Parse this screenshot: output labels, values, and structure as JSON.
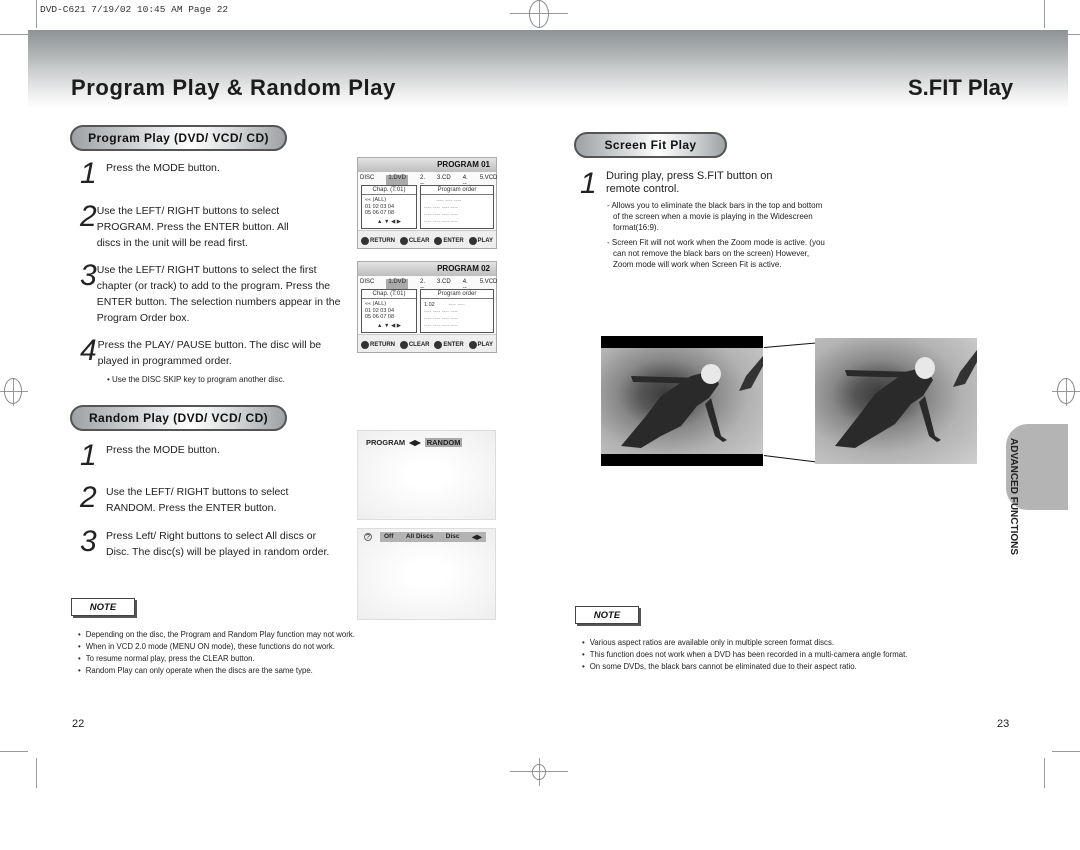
{
  "print_header": "DVD-C621  7/19/02 10:45 AM  Page 22",
  "left_page": {
    "title": "Program Play & Random Play",
    "page_number": "22",
    "program_section": {
      "heading": "Program Play (DVD/ VCD/ CD)",
      "steps": [
        {
          "num": "1",
          "text": "Press the MODE button."
        },
        {
          "num": "2",
          "text": "Use the LEFT/ RIGHT buttons to select PROGRAM. Press the ENTER button. All discs in the unit will be read first."
        },
        {
          "num": "3",
          "text": "Use the LEFT/ RIGHT buttons to select the first chapter (or track) to add to the program. Press the ENTER button. The selection numbers appear in the Program Order box."
        },
        {
          "num": "4",
          "text": "Press the PLAY/ PAUSE button. The disc will be played in programmed order."
        }
      ],
      "tip": "• Use the DISC SKIP key to program another disc."
    },
    "osd_screens": [
      {
        "title": "PROGRAM 01",
        "discs": [
          "DISC",
          "1.DVD",
          "2. ---",
          "3.CD",
          "4. ---",
          "5.VCD"
        ],
        "chap_header": "Chap. (T:01)",
        "all_label": "«« (ALL)",
        "chapters_row1": "01  02  03  04",
        "chapters_row2": "05  06  07  08",
        "arrows": "▲ ▼ ◀ ▶",
        "order_header": "Program order",
        "order_first": "",
        "footer": [
          "RETURN",
          "CLEAR",
          "ENTER",
          "PLAY"
        ]
      },
      {
        "title": "PROGRAM 02",
        "discs": [
          "DISC",
          "1.DVD",
          "2. ---",
          "3.CD",
          "4. ---",
          "5.VCD"
        ],
        "chap_header": "Chap. (T:01)",
        "all_label": "«« (ALL)",
        "chapters_row1": "01  02  03  04",
        "chapters_row2": "05  06  07  08",
        "arrows": "▲ ▼ ◀ ▶",
        "order_header": "Program order",
        "order_first": "1.02",
        "footer": [
          "RETURN",
          "CLEAR",
          "ENTER",
          "PLAY"
        ]
      }
    ],
    "random_section": {
      "heading": "Random Play (DVD/ VCD/ CD)",
      "steps": [
        {
          "num": "1",
          "text": "Press the MODE button."
        },
        {
          "num": "2",
          "text": "Use the LEFT/ RIGHT buttons to select RANDOM. Press the ENTER button."
        },
        {
          "num": "3",
          "text": "Press Left/ Right buttons to select All discs or Disc. The disc(s) will be played in random order."
        }
      ]
    },
    "random_osd": {
      "program_label": "PROGRAM",
      "arrows": "◀▶",
      "random_label": "RANDOM",
      "icon": "?",
      "options": [
        "Off",
        "All Discs",
        "Disc"
      ]
    },
    "note_label": "NOTE",
    "notes": [
      "Depending on the disc, the Program and Random Play function may not work.",
      "When in VCD 2.0 mode (MENU ON mode), these functions do not work.",
      "To resume normal play, press the CLEAR button.",
      "Random Play can only operate when the discs are the same type."
    ]
  },
  "right_page": {
    "title": "S.FIT Play",
    "page_number": "23",
    "section_heading": "Screen Fit Play",
    "step": {
      "num": "1",
      "text": "During play, press S.FIT button on remote control."
    },
    "details": [
      "- Allows you to eliminate the black bars in the top and bottom of the screen when a movie is playing in the Widescreen format(16:9).",
      "- Screen Fit will not work when the Zoom mode is active. (you can not remove the black bars on the screen) However, Zoom mode will work when Screen Fit is active."
    ],
    "side_tab": "ADVANCED FUNCTIONS",
    "note_label": "NOTE",
    "notes": [
      "Various aspect ratios are available only in multiple screen format discs.",
      "This function does not work when a DVD has been recorded in a multi-camera angle format.",
      "On some DVDs, the black bars cannot be eliminated due to their aspect ratio."
    ]
  }
}
